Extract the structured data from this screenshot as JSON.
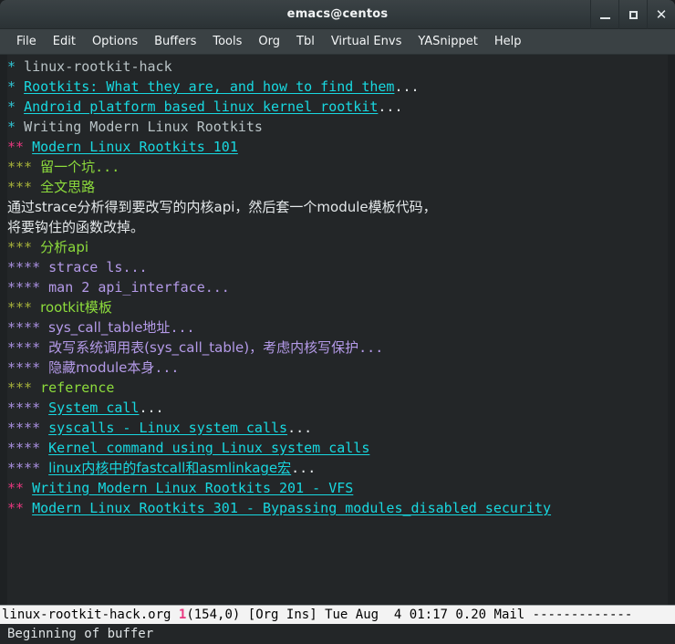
{
  "window": {
    "title": "emacs@centos",
    "controls": {
      "minimize": "minimize-button",
      "maximize": "maximize-button",
      "close": "close-button",
      "close_glyph": "✕"
    }
  },
  "menubar": {
    "items": [
      "File",
      "Edit",
      "Options",
      "Buffers",
      "Tools",
      "Org",
      "Tbl",
      "Virtual Envs",
      "YASnippet",
      "Help"
    ]
  },
  "buffer": {
    "lines": [
      {
        "stars": "*",
        "level": 1,
        "text": "linux-rootkit-hack",
        "style": "plain"
      },
      {
        "stars": "*",
        "level": 1,
        "text": "Rootkits: What they are, and how to find them",
        "style": "link",
        "suffix": "..."
      },
      {
        "stars": "*",
        "level": 1,
        "text": "Android platform based linux kernel rootkit",
        "style": "link",
        "suffix": "..."
      },
      {
        "stars": "*",
        "level": 1,
        "text": "Writing Modern Linux Rootkits",
        "style": "plain"
      },
      {
        "stars": "**",
        "level": 2,
        "text": "Modern Linux Rootkits 101",
        "style": "link"
      },
      {
        "stars": "***",
        "level": 3,
        "text": "留一个坑",
        "style": "head",
        "suffix": "..."
      },
      {
        "stars": "***",
        "level": 3,
        "text": "全文思路",
        "style": "head"
      },
      {
        "stars": "",
        "level": 0,
        "text": "通过strace分析得到要改写的内核api，然后套一个module模板代码，",
        "style": "body"
      },
      {
        "stars": "",
        "level": 0,
        "text": "将要钩住的函数改掉。",
        "style": "body"
      },
      {
        "stars": "***",
        "level": 3,
        "text": "分析api",
        "style": "head"
      },
      {
        "stars": "****",
        "level": 4,
        "text": "strace ls",
        "style": "head",
        "suffix": "..."
      },
      {
        "stars": "****",
        "level": 4,
        "text": "man 2 api_interface",
        "style": "head",
        "suffix": "..."
      },
      {
        "stars": "***",
        "level": 3,
        "text": "rootkit模板",
        "style": "head"
      },
      {
        "stars": "****",
        "level": 4,
        "text": "sys_call_table地址",
        "style": "head",
        "suffix": "..."
      },
      {
        "stars": "****",
        "level": 4,
        "text": "改写系统调用表(sys_call_table)，考虑内核写保护",
        "style": "head",
        "suffix": "..."
      },
      {
        "stars": "****",
        "level": 4,
        "text": "隐藏module本身",
        "style": "head",
        "suffix": "..."
      },
      {
        "stars": "***",
        "level": 3,
        "text": "reference",
        "style": "head"
      },
      {
        "stars": "****",
        "level": 4,
        "text": "System call",
        "style": "link",
        "suffix": "..."
      },
      {
        "stars": "****",
        "level": 4,
        "text": "syscalls - Linux system calls",
        "style": "link",
        "suffix": "..."
      },
      {
        "stars": "****",
        "level": 4,
        "text": "Kernel command using Linux system calls",
        "style": "link"
      },
      {
        "stars": "****",
        "level": 4,
        "text": "linux内核中的fastcall和asmlinkage宏",
        "style": "link",
        "suffix": "..."
      },
      {
        "stars": "**",
        "level": 2,
        "text": "Writing Modern Linux Rootkits 201 - VFS",
        "style": "link"
      },
      {
        "stars": "**",
        "level": 2,
        "text": "Modern Linux Rootkits 301 - Bypassing modules_disabled security",
        "style": "link"
      }
    ]
  },
  "modeline": {
    "buffer_name": "linux-rootkit-hack.org",
    "modified_flag": "1",
    "position": "(154,0)",
    "modes": "[Org Ins]",
    "datetime": "Tue Aug  4 01:17",
    "load": "0.20",
    "mail": "Mail",
    "filler": "-------------"
  },
  "echo": {
    "message": "Beginning of buffer"
  },
  "colors": {
    "background": "#232628",
    "titlebar": "#343c3f",
    "menubar": "#3a4144",
    "level1_star": "#2fc4d4",
    "level2_star": "#e8377f",
    "level3_star": "#a8b33a",
    "level4_star": "#a98fe0",
    "link": "#18d8e0",
    "body_text": "#e4e8ea",
    "modeline_bg": "#f3f3f3",
    "modeline_fg": "#000000"
  }
}
